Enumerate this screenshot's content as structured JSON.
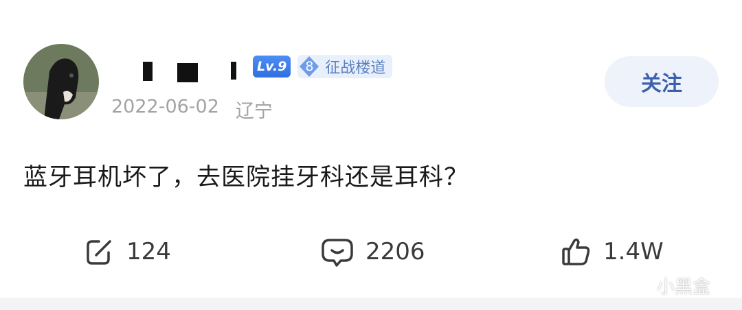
{
  "user": {
    "level": "Lv.9",
    "medal": {
      "number": "8",
      "name": "征战楼道"
    },
    "date": "2022-06-02",
    "location": "辽宁"
  },
  "follow_label": "关注",
  "post": {
    "text": "蓝牙耳机坏了，去医院挂牙科还是耳科？"
  },
  "actions": {
    "share_count": "124",
    "comment_count": "2206",
    "like_count": "1.4W"
  },
  "watermark": {
    "text": "小黑盒"
  },
  "colors": {
    "accent": "#3c5fae",
    "follow_bg": "#eef2fb",
    "meta_text": "#a3a3a3",
    "level_badge": "#2f6fe0",
    "medal_bg": "#e8f0fc"
  }
}
